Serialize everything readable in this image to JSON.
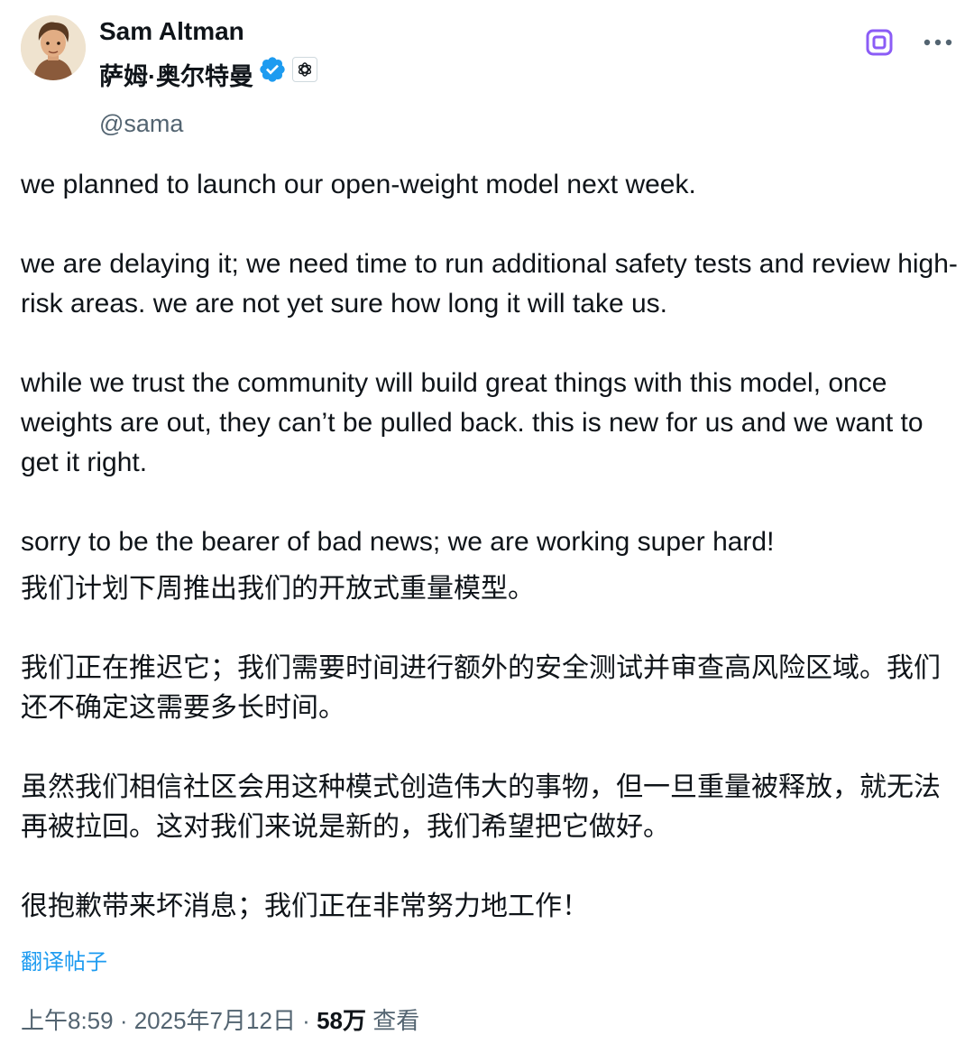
{
  "author": {
    "display_name": "Sam Altman",
    "cn_name": "萨姆·奥尔特曼",
    "handle": "@sama",
    "verified": true,
    "affiliation_icon": "openai-logo-icon",
    "avatar_icon": "avatar-illustration"
  },
  "actions": {
    "grok_icon": "grok-icon",
    "more_icon": "more-horizontal-icon"
  },
  "post": {
    "en_text": "we planned to launch our open-weight model next week.\n\nwe are delaying it; we need time to run additional safety tests and review high-risk areas. we are not yet sure how long it will take us.\n\nwhile we trust the community will build great things with this model, once weights are out, they can’t be pulled back. this is new for us and we want to get it right.\n\nsorry to be the bearer of bad news; we are working super hard!",
    "zh_text": "我们计划下周推出我们的开放式重量模型。\n\n我们正在推迟它；我们需要时间进行额外的安全测试并审查高风险区域。我们还不确定这需要多长时间。\n\n虽然我们相信社区会用这种模式创造伟大的事物，但一旦重量被释放，就无法再被拉回。这对我们来说是新的，我们希望把它做好。\n\n很抱歉带来坏消息；我们正在非常努力地工作！",
    "translate_label": "翻译帖子"
  },
  "meta": {
    "time": "上午8:59",
    "separator": " · ",
    "date": "2025年7月12日",
    "views_count": "58万",
    "views_label": " 查看"
  },
  "colors": {
    "text": "#0f1419",
    "secondary": "#536471",
    "link": "#1d9bf0",
    "verified": "#1d9bf0",
    "grok": "#8b5cf6"
  }
}
